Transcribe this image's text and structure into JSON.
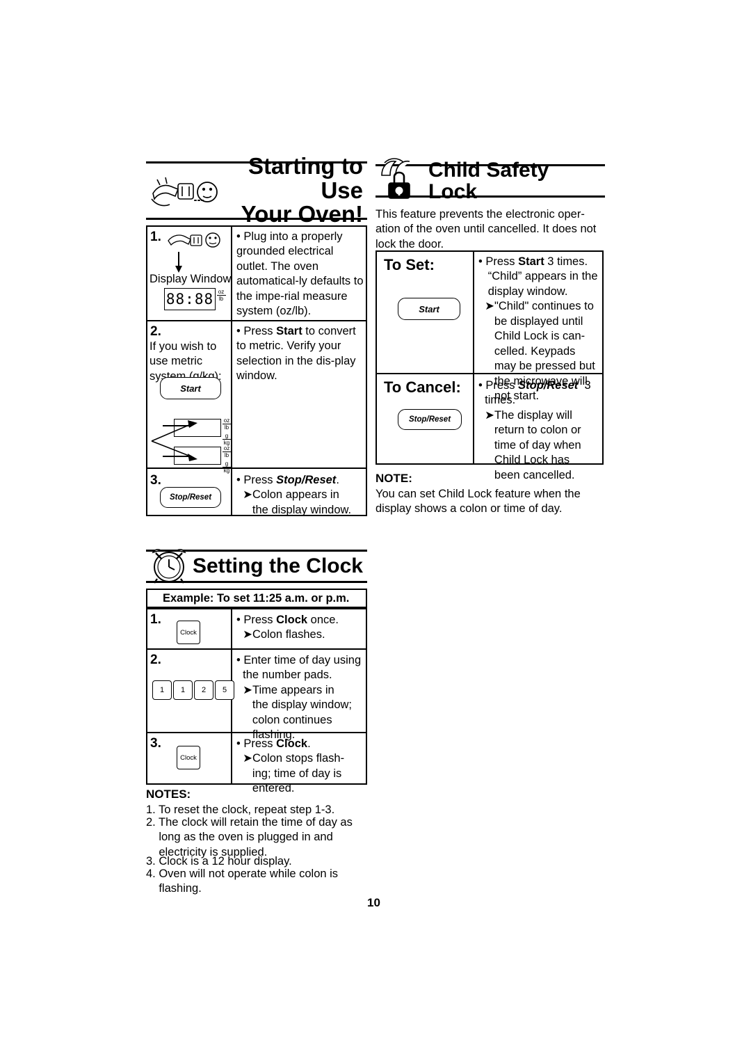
{
  "page_number": "10",
  "sections": {
    "starting": {
      "title_line1": "Starting to Use",
      "title_line2": "Your Oven!",
      "icon": "plug-outlet-icon",
      "rows": [
        {
          "num": "1.",
          "display_window_label": "Display Window",
          "lcd": "88:88",
          "text": "• Plug into a properly grounded electrical outlet. The oven automatical-ly defaults to the impe-rial measure system (oz/lb)."
        },
        {
          "num": "2.",
          "metric_label_line1": "If you wish to",
          "metric_label_line2": "use metric",
          "metric_label_line3": "system (g/kg):",
          "key": "Start",
          "text": "• Press Start to convert to metric. Verify your selection in the dis-play window."
        },
        {
          "num": "3.",
          "key": "Stop/Reset",
          "text": "• Press Stop/Reset. ➤Colon appears in the display window."
        }
      ]
    },
    "child_lock": {
      "title": "Child Safety Lock",
      "icon": "padlock-icon",
      "intro": "This feature prevents the electronic oper-ation of the oven until cancelled. It does not lock the door.",
      "to_set_label": "To Set:",
      "to_set_key": "Start",
      "to_set_text": "• Press Start 3 times. “Child” appears in the display window. ➤\"Child\" continues to be displayed until Child Lock is can-celled. Keypads may be pressed but the microwave will not start.",
      "to_cancel_label": "To Cancel:",
      "to_cancel_key": "Stop/Reset",
      "to_cancel_text": "• Press Stop/Reset  3 times. ➤The display will return to colon or time of day when Child Lock has been cancelled.",
      "note_heading": "NOTE:",
      "note_text": "You can set Child Lock feature when the display shows a colon or time of day."
    },
    "clock": {
      "title": "Setting the Clock",
      "icon": "alarm-clock-icon",
      "example": "Example: To set 11:25 a.m. or p.m.",
      "rows": [
        {
          "num": "1.",
          "key": "Clock",
          "text": "• Press Clock once. ➤Colon flashes."
        },
        {
          "num": "2.",
          "keys": [
            "1",
            "1",
            "2",
            "5"
          ],
          "text": "• Enter time of day using the number pads. ➤Time appears in the display window; colon continues flashing."
        },
        {
          "num": "3.",
          "key": "Clock",
          "text": "• Press Clock. ➤Colon stops flash-ing; time of day is entered."
        }
      ],
      "notes_heading": "NOTES:",
      "notes": [
        "1. To reset the clock, repeat step 1-3.",
        "2. The clock will retain the time of day as long as the oven is plugged in and electricity is supplied.",
        "3. Clock is a 12 hour display.",
        "4. Oven will not operate while colon is flashing."
      ]
    }
  },
  "units": {
    "oz": "oz",
    "lb": "lb",
    "g": "g",
    "kg": "kg"
  }
}
